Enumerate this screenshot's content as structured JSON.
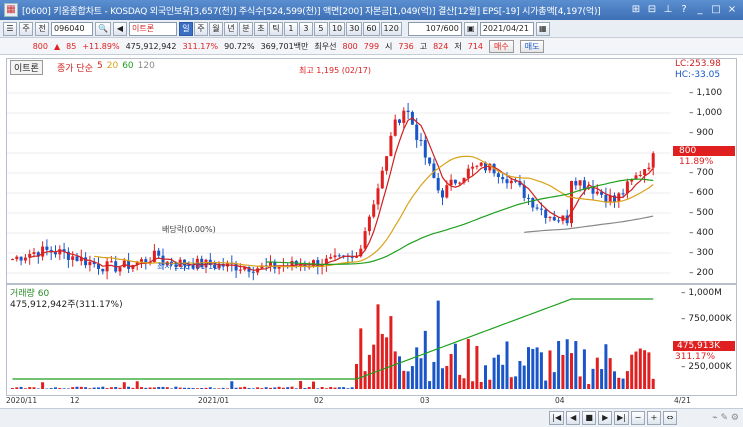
{
  "window": {
    "title": "[0600] 키움종합차트 - KOSDAQ 외국인보유[3,657(천)] 주식수[524,599(천)] 액면[200] 자본금[1,049(억)] 결산[12월] EPS[-19] 시가총액[4,197(억)]"
  },
  "toolbar": {
    "stock_code": "096040",
    "stock_name": "이트론",
    "jeon": "전",
    "ju_label": "주",
    "periods": [
      "일",
      "주",
      "월",
      "년",
      "분",
      "초",
      "틱",
      "1",
      "3",
      "5",
      "10",
      "30",
      "60",
      "120"
    ],
    "selected_period": "일",
    "count": "107/600",
    "date": "2021/04/21"
  },
  "price": {
    "current": "800",
    "change": "85",
    "change_pct": "+11.89%",
    "volume": "475,912,942",
    "vol_ratio": "311.17%",
    "strength": "90.72%",
    "trade_amount": "369,701백만",
    "best_ask_label": "최우선",
    "best_ask": "800",
    "best_bid": "799",
    "open_label": "시",
    "open": "736",
    "high_label": "고",
    "high": "824",
    "low_label": "저",
    "low": "714",
    "buy_label": "매수",
    "sell_label": "매도"
  },
  "price_panel": {
    "tab": "이트론",
    "legend": {
      "name": "종가 단순",
      "ma": [
        "5",
        "20",
        "60",
        "120"
      ]
    },
    "lc": "LC:253.98",
    "hc": "HC:-33.05",
    "annotations": {
      "high": "최고 1,195 (02/17)",
      "low": "최저 226 (01/11)",
      "ex_div": "배당락(0.00%)"
    },
    "y_labels": [
      "1,100",
      "1,000",
      "900",
      "800",
      "700",
      "600",
      "500",
      "400",
      "300",
      "200"
    ],
    "current_label": "800",
    "current_pct": "11.89%"
  },
  "volume_panel": {
    "legend_name": "거래량",
    "legend_ma": "60",
    "value_label": "475,912,942주(311.17%)",
    "y_labels": [
      "1,000M",
      "750,000K",
      "250,000K"
    ],
    "current_label": "475,913K",
    "current_pct": "311.17%"
  },
  "x_labels": [
    "2020/11",
    "12",
    "2021/01",
    "02",
    "03",
    "04",
    "4/21"
  ],
  "colors": {
    "up": "#e02020",
    "down": "#1a56c8",
    "ma5": "#d02020",
    "ma20": "#d9a21a",
    "ma60": "#1ea01e",
    "ma120": "#8a8a8a"
  }
}
